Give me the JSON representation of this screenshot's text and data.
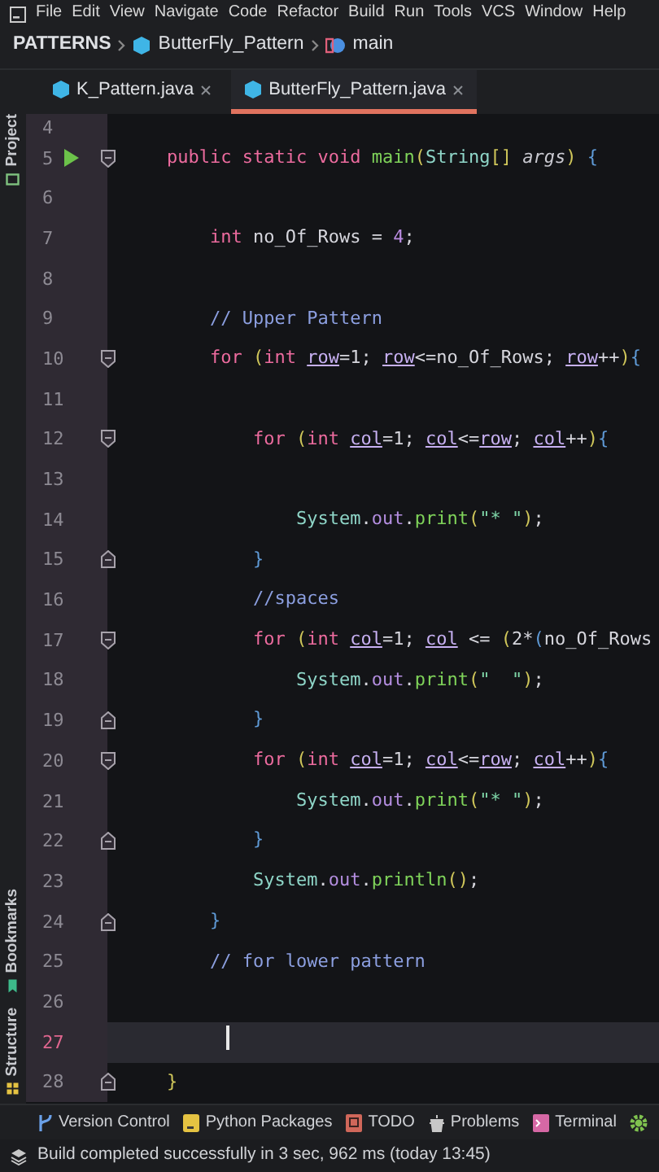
{
  "menu": [
    "File",
    "Edit",
    "View",
    "Navigate",
    "Code",
    "Refactor",
    "Build",
    "Run",
    "Tools",
    "VCS",
    "Window",
    "Help"
  ],
  "breadcrumb": [
    {
      "kind": "project",
      "text": "PATTERNS"
    },
    {
      "kind": "class",
      "text": "ButterFly_Pattern"
    },
    {
      "kind": "method",
      "text": "main"
    }
  ],
  "tabs": [
    {
      "label": "K_Pattern.java",
      "selected": false
    },
    {
      "label": "ButterFly_Pattern.java",
      "selected": true
    }
  ],
  "side_tools": {
    "top": [
      {
        "kind": "project",
        "label": "Project"
      }
    ],
    "bottom": [
      {
        "kind": "bookmarks",
        "label": "Bookmarks"
      },
      {
        "kind": "structure",
        "label": "Structure"
      }
    ]
  },
  "lines": [
    {
      "number": "4",
      "current": false,
      "run": false,
      "caret": false,
      "fold_start": false,
      "fold_end": false
    },
    {
      "number": "5",
      "current": false,
      "run": true,
      "caret": false,
      "fold_start": true,
      "fold_end": false,
      "tokens": [
        {
          "kind": "kw",
          "text": "    public static void "
        },
        {
          "kind": "fn",
          "text": "main"
        },
        {
          "kind": "paren",
          "text": "("
        },
        {
          "kind": "cls",
          "text": "String"
        },
        {
          "kind": "paren",
          "text": "[] "
        },
        {
          "kind": "param",
          "text": "args"
        },
        {
          "kind": "paren",
          "text": ")"
        },
        {
          "kind": "brace",
          "text": " {"
        }
      ]
    },
    {
      "number": "6",
      "current": false,
      "run": false,
      "caret": false,
      "fold_start": false,
      "fold_end": false
    },
    {
      "number": "7",
      "current": false,
      "run": false,
      "caret": false,
      "fold_start": false,
      "fold_end": false,
      "tokens": [
        {
          "kind": "kw",
          "text": "        int "
        },
        {
          "kind": "plain",
          "text": "no_Of_Rows = "
        },
        {
          "kind": "num",
          "text": "4"
        },
        {
          "kind": "plain",
          "text": ";"
        }
      ]
    },
    {
      "number": "8",
      "current": false,
      "run": false,
      "caret": false,
      "fold_start": false,
      "fold_end": false
    },
    {
      "number": "9",
      "current": false,
      "run": false,
      "caret": false,
      "fold_start": false,
      "fold_end": false,
      "tokens": [
        {
          "kind": "cmt",
          "text": "        // Upper Pattern"
        }
      ]
    },
    {
      "number": "10",
      "current": false,
      "run": false,
      "caret": false,
      "fold_start": true,
      "fold_end": false,
      "tokens": [
        {
          "kind": "kw",
          "text": "        for "
        },
        {
          "kind": "paren",
          "text": "("
        },
        {
          "kind": "kw",
          "text": "int "
        },
        {
          "kind": "var",
          "text": "row"
        },
        {
          "kind": "plain",
          "text": "=1; "
        },
        {
          "kind": "var",
          "text": "row"
        },
        {
          "kind": "plain",
          "text": "<=no_Of_Rows; "
        },
        {
          "kind": "var",
          "text": "row"
        },
        {
          "kind": "plain",
          "text": "++"
        },
        {
          "kind": "paren",
          "text": ")"
        },
        {
          "kind": "brace",
          "text": "{"
        }
      ]
    },
    {
      "number": "11",
      "current": false,
      "run": false,
      "caret": false,
      "fold_start": false,
      "fold_end": false
    },
    {
      "number": "12",
      "current": false,
      "run": false,
      "caret": false,
      "fold_start": true,
      "fold_end": false,
      "tokens": [
        {
          "kind": "kw",
          "text": "            for "
        },
        {
          "kind": "paren",
          "text": "("
        },
        {
          "kind": "kw",
          "text": "int "
        },
        {
          "kind": "var",
          "text": "col"
        },
        {
          "kind": "plain",
          "text": "=1; "
        },
        {
          "kind": "var",
          "text": "col"
        },
        {
          "kind": "plain",
          "text": "<="
        },
        {
          "kind": "var",
          "text": "row"
        },
        {
          "kind": "plain",
          "text": "; "
        },
        {
          "kind": "var",
          "text": "col"
        },
        {
          "kind": "plain",
          "text": "++"
        },
        {
          "kind": "paren",
          "text": ")"
        },
        {
          "kind": "brace",
          "text": "{"
        }
      ]
    },
    {
      "number": "13",
      "current": false,
      "run": false,
      "caret": false,
      "fold_start": false,
      "fold_end": false
    },
    {
      "number": "14",
      "current": false,
      "run": false,
      "caret": false,
      "fold_start": false,
      "fold_end": false,
      "tokens": [
        {
          "kind": "cls",
          "text": "                System"
        },
        {
          "kind": "plain",
          "text": "."
        },
        {
          "kind": "field",
          "text": "out"
        },
        {
          "kind": "plain",
          "text": "."
        },
        {
          "kind": "fn",
          "text": "print"
        },
        {
          "kind": "paren",
          "text": "("
        },
        {
          "kind": "str",
          "text": "\"* \""
        },
        {
          "kind": "paren",
          "text": ")"
        },
        {
          "kind": "plain",
          "text": ";"
        }
      ]
    },
    {
      "number": "15",
      "current": false,
      "run": false,
      "caret": false,
      "fold_start": false,
      "fold_end": true,
      "tokens": [
        {
          "kind": "brace",
          "text": "            }"
        }
      ]
    },
    {
      "number": "16",
      "current": false,
      "run": false,
      "caret": false,
      "fold_start": false,
      "fold_end": false,
      "tokens": [
        {
          "kind": "cmt",
          "text": "            //spaces"
        }
      ]
    },
    {
      "number": "17",
      "current": false,
      "run": false,
      "caret": false,
      "fold_start": true,
      "fold_end": false,
      "tokens": [
        {
          "kind": "kw",
          "text": "            for "
        },
        {
          "kind": "paren",
          "text": "("
        },
        {
          "kind": "kw",
          "text": "int "
        },
        {
          "kind": "var",
          "text": "col"
        },
        {
          "kind": "plain",
          "text": "=1; "
        },
        {
          "kind": "var",
          "text": "col"
        },
        {
          "kind": "plain",
          "text": " <= "
        },
        {
          "kind": "paren",
          "text": "("
        },
        {
          "kind": "plain",
          "text": "2*"
        },
        {
          "kind": "brace",
          "text": "("
        },
        {
          "kind": "plain",
          "text": "no_Of_Rows"
        }
      ]
    },
    {
      "number": "18",
      "current": false,
      "run": false,
      "caret": false,
      "fold_start": false,
      "fold_end": false,
      "tokens": [
        {
          "kind": "cls",
          "text": "                System"
        },
        {
          "kind": "plain",
          "text": "."
        },
        {
          "kind": "field",
          "text": "out"
        },
        {
          "kind": "plain",
          "text": "."
        },
        {
          "kind": "fn",
          "text": "print"
        },
        {
          "kind": "paren",
          "text": "("
        },
        {
          "kind": "str",
          "text": "\"  \""
        },
        {
          "kind": "paren",
          "text": ")"
        },
        {
          "kind": "plain",
          "text": ";"
        }
      ]
    },
    {
      "number": "19",
      "current": false,
      "run": false,
      "caret": false,
      "fold_start": false,
      "fold_end": true,
      "tokens": [
        {
          "kind": "brace",
          "text": "            }"
        }
      ]
    },
    {
      "number": "20",
      "current": false,
      "run": false,
      "caret": false,
      "fold_start": true,
      "fold_end": false,
      "tokens": [
        {
          "kind": "kw",
          "text": "            for "
        },
        {
          "kind": "paren",
          "text": "("
        },
        {
          "kind": "kw",
          "text": "int "
        },
        {
          "kind": "var",
          "text": "col"
        },
        {
          "kind": "plain",
          "text": "=1; "
        },
        {
          "kind": "var",
          "text": "col"
        },
        {
          "kind": "plain",
          "text": "<="
        },
        {
          "kind": "var",
          "text": "row"
        },
        {
          "kind": "plain",
          "text": "; "
        },
        {
          "kind": "var",
          "text": "col"
        },
        {
          "kind": "plain",
          "text": "++"
        },
        {
          "kind": "paren",
          "text": ")"
        },
        {
          "kind": "brace",
          "text": "{"
        }
      ]
    },
    {
      "number": "21",
      "current": false,
      "run": false,
      "caret": false,
      "fold_start": false,
      "fold_end": false,
      "tokens": [
        {
          "kind": "cls",
          "text": "                System"
        },
        {
          "kind": "plain",
          "text": "."
        },
        {
          "kind": "field",
          "text": "out"
        },
        {
          "kind": "plain",
          "text": "."
        },
        {
          "kind": "fn",
          "text": "print"
        },
        {
          "kind": "paren",
          "text": "("
        },
        {
          "kind": "str",
          "text": "\"* \""
        },
        {
          "kind": "paren",
          "text": ")"
        },
        {
          "kind": "plain",
          "text": ";"
        }
      ]
    },
    {
      "number": "22",
      "current": false,
      "run": false,
      "caret": false,
      "fold_start": false,
      "fold_end": true,
      "tokens": [
        {
          "kind": "brace",
          "text": "            }"
        }
      ]
    },
    {
      "number": "23",
      "current": false,
      "run": false,
      "caret": false,
      "fold_start": false,
      "fold_end": false,
      "tokens": [
        {
          "kind": "cls",
          "text": "            System"
        },
        {
          "kind": "plain",
          "text": "."
        },
        {
          "kind": "field",
          "text": "out"
        },
        {
          "kind": "plain",
          "text": "."
        },
        {
          "kind": "fn",
          "text": "println"
        },
        {
          "kind": "paren",
          "text": "()"
        },
        {
          "kind": "plain",
          "text": ";"
        }
      ]
    },
    {
      "number": "24",
      "current": false,
      "run": false,
      "caret": false,
      "fold_start": false,
      "fold_end": true,
      "tokens": [
        {
          "kind": "brace",
          "text": "        }"
        }
      ]
    },
    {
      "number": "25",
      "current": false,
      "run": false,
      "caret": false,
      "fold_start": false,
      "fold_end": false,
      "tokens": [
        {
          "kind": "cmt",
          "text": "        // for lower pattern"
        }
      ]
    },
    {
      "number": "26",
      "current": false,
      "run": false,
      "caret": false,
      "fold_start": false,
      "fold_end": false
    },
    {
      "number": "27",
      "current": true,
      "run": false,
      "caret": true,
      "fold_start": false,
      "fold_end": false
    },
    {
      "number": "28",
      "current": false,
      "run": false,
      "caret": false,
      "fold_start": false,
      "fold_end": true,
      "tokens": [
        {
          "kind": "paren",
          "text": "    }"
        }
      ]
    }
  ],
  "tool_windows": [
    {
      "kind": "vcs",
      "label": "Version Control"
    },
    {
      "kind": "packages",
      "label": "Python Packages"
    },
    {
      "kind": "todo",
      "label": "TODO"
    },
    {
      "kind": "problems",
      "label": "Problems"
    },
    {
      "kind": "terminal",
      "label": "Terminal"
    },
    {
      "kind": "settings"
    }
  ],
  "status_bar": {
    "message": "Build completed successfully in 3 sec, 962 ms (today 13:45)"
  }
}
